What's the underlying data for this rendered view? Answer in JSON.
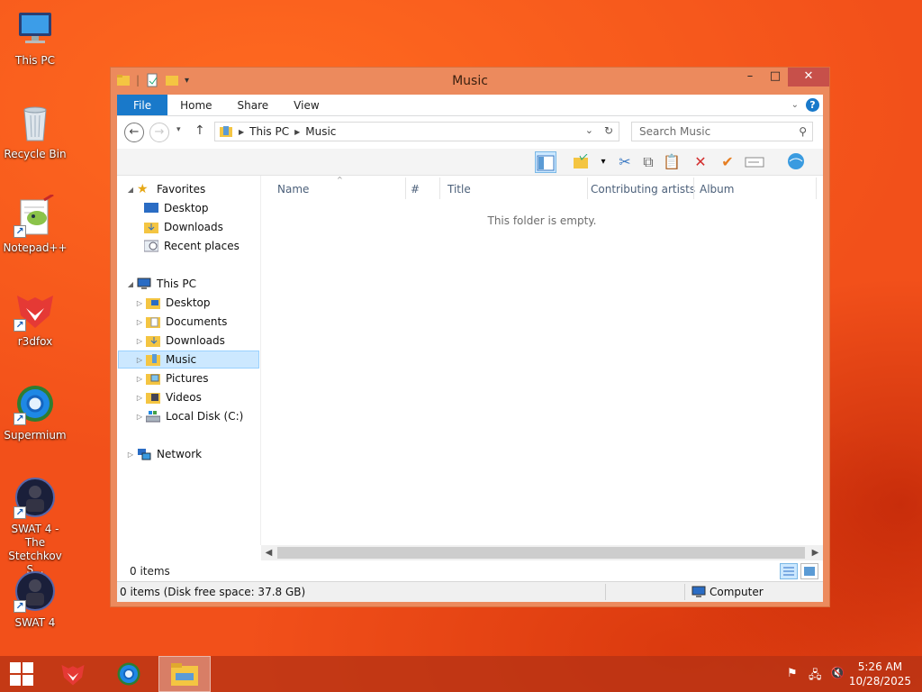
{
  "desktop": {
    "icons": [
      {
        "label": "This PC",
        "icon": "this-pc-icon"
      },
      {
        "label": "Recycle Bin",
        "icon": "recycle-bin-icon"
      },
      {
        "label": "Notepad++",
        "icon": "notepad-plus-plus-icon"
      },
      {
        "label": "r3dfox",
        "icon": "r3dfox-icon"
      },
      {
        "label": "Supermium",
        "icon": "supermium-icon"
      },
      {
        "label": "SWAT 4 - The Stetchkov S...",
        "icon": "swat4-stetchkov-icon"
      },
      {
        "label": "SWAT 4",
        "icon": "swat4-icon"
      }
    ]
  },
  "window": {
    "title": "Music",
    "controls": {
      "minimize": "–",
      "maximize": "□",
      "close": "✕"
    },
    "ribbon_tabs": [
      "File",
      "Home",
      "Share",
      "View"
    ],
    "breadcrumb": [
      "This PC",
      "Music"
    ],
    "search_placeholder": "Search Music",
    "nav": {
      "favorites": {
        "label": "Favorites",
        "items": [
          "Desktop",
          "Downloads",
          "Recent places"
        ]
      },
      "this_pc": {
        "label": "This PC",
        "items": [
          "Desktop",
          "Documents",
          "Downloads",
          "Music",
          "Pictures",
          "Videos",
          "Local Disk (C:)"
        ],
        "selected": "Music"
      },
      "network": {
        "label": "Network"
      }
    },
    "columns": [
      "Name",
      "#",
      "Title",
      "Contributing artists",
      "Album"
    ],
    "empty_message": "This folder is empty.",
    "items_count": "0 items",
    "status": {
      "left": "0 items (Disk free space: 37.8 GB)",
      "right": "Computer"
    }
  },
  "taskbar": {
    "apps": [
      "start-button",
      "r3dfox",
      "supermium",
      "file-explorer"
    ],
    "clock": {
      "time": "5:26 AM",
      "date": "10/28/2025"
    }
  },
  "colors": {
    "accent": "#1979ca",
    "window_frame": "#ec8a5d",
    "close_button": "#c7504a",
    "selection": "#cce8ff"
  }
}
